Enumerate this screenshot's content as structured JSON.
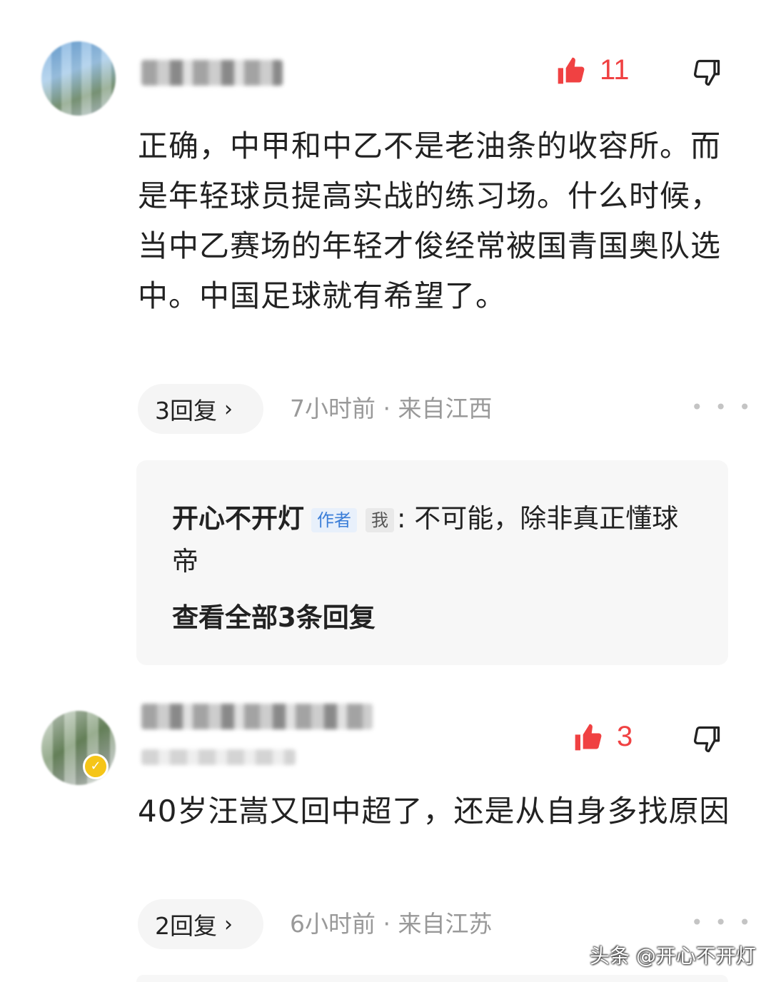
{
  "comments": [
    {
      "like_count": "11",
      "text": "正确，中甲和中乙不是老油条的收容所。而是年轻球员提高实战的练习场。什么时候，当中乙赛场的年轻才俊经常被国青国奥队选中。中国足球就有希望了。",
      "reply_button": "3回复",
      "meta": "7小时前 · 来自江西",
      "reply_preview": {
        "author": "开心不开灯",
        "tag_author": "作者",
        "tag_me": "我",
        "separator": ":",
        "text": "不可能，除非真正懂球帝",
        "view_all": "查看全部3条回复"
      }
    },
    {
      "like_count": "3",
      "text": "40岁汪嵩又回中超了，还是从自身多找原因",
      "reply_button": "2回复",
      "meta": "6小时前 · 来自江苏"
    }
  ],
  "icons": {
    "like": "thumbs-up-icon",
    "dislike": "thumbs-down-icon",
    "more": "more-dots-icon",
    "verified": "verified-badge-icon"
  },
  "colors": {
    "like_red": "#f04142",
    "meta_gray": "#999999",
    "author_tag_blue": "#3b7ed8"
  },
  "watermark": "头条 @开心不开灯"
}
